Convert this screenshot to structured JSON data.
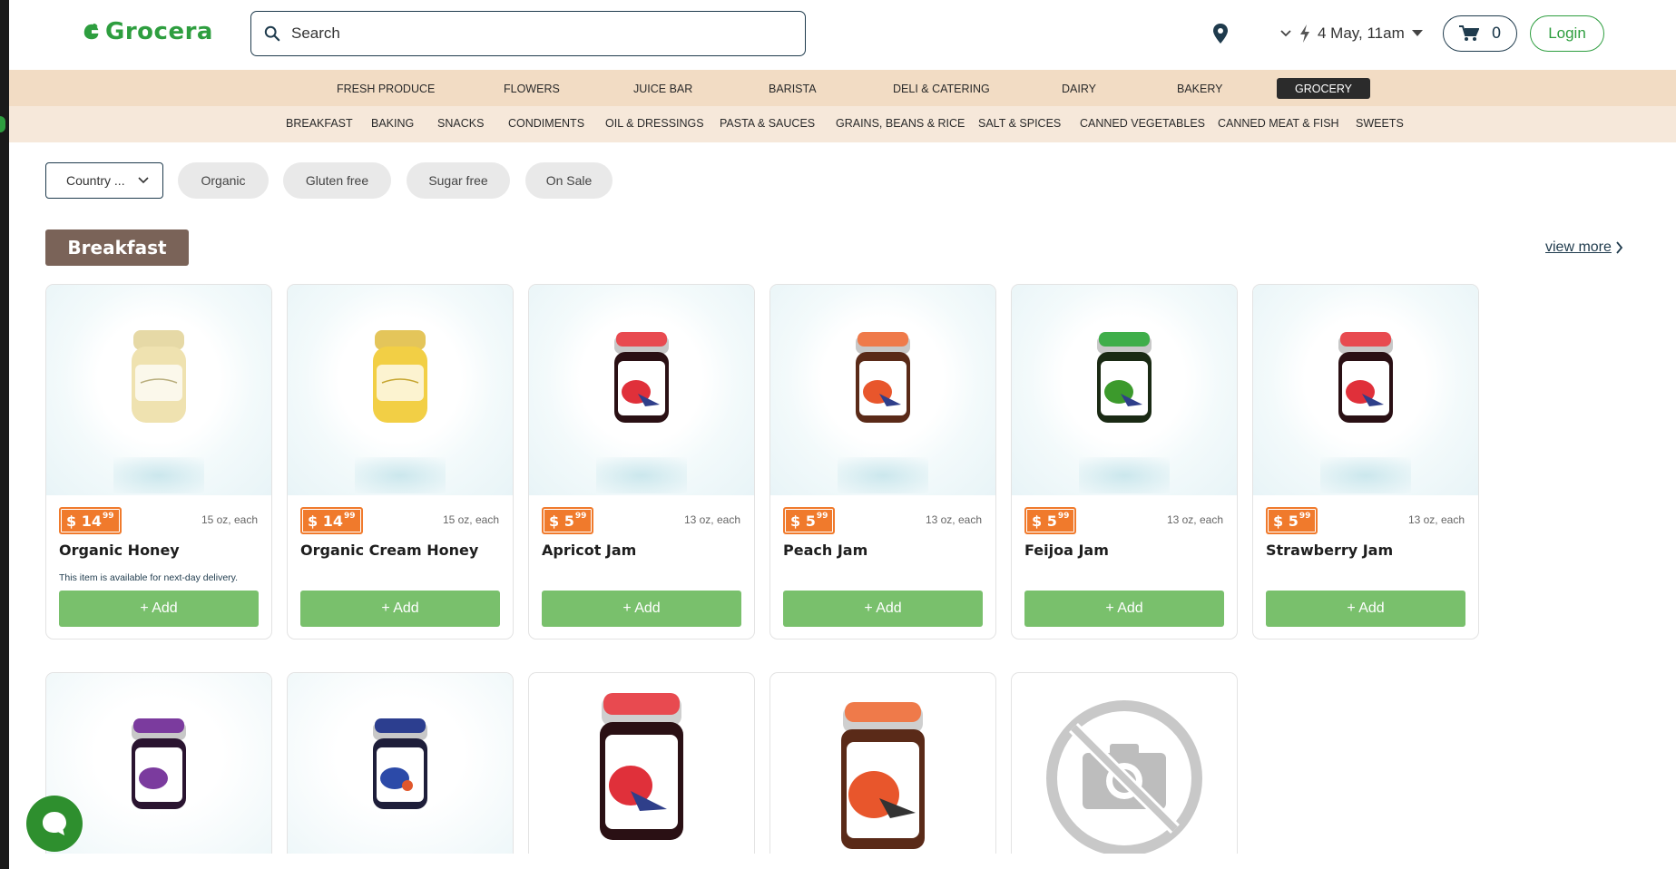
{
  "brand": {
    "name": "Grocera",
    "accent": "#2e9e3f"
  },
  "search": {
    "placeholder": "Search"
  },
  "delivery": {
    "label": "4 May, 11am"
  },
  "cart": {
    "count": "0"
  },
  "login": {
    "label": "Login"
  },
  "nav_main": [
    "FRESH PRODUCE",
    "FLOWERS",
    "JUICE BAR",
    "BARISTA",
    "DELI & CATERING",
    "DAIRY",
    "BAKERY",
    "GROCERY"
  ],
  "nav_sub": [
    "BREAKFAST",
    "BAKING",
    "SNACKS",
    "CONDIMENTS",
    "OIL & DRESSINGS",
    "PASTA & SAUCES",
    "GRAINS, BEANS & RICE",
    "SALT & SPICES",
    "CANNED VEGETABLES",
    "CANNED MEAT & FISH",
    "SWEETS"
  ],
  "filters": {
    "country": "Country ...",
    "pills": [
      "Organic",
      "Gluten free",
      "Sugar free",
      "On Sale"
    ]
  },
  "section": {
    "title": "Breakfast",
    "view_more": "view more"
  },
  "products": [
    {
      "name": "Organic Honey",
      "price_main": "$ 14",
      "price_cents": "99",
      "size": "15 oz, each",
      "note": "This item is available for next-day delivery.",
      "add": "+ Add",
      "jar": "honey"
    },
    {
      "name": "Organic Cream Honey",
      "price_main": "$ 14",
      "price_cents": "99",
      "size": "15 oz, each",
      "add": "+ Add",
      "jar": "cream-honey"
    },
    {
      "name": "Apricot Jam",
      "price_main": "$ 5",
      "price_cents": "99",
      "size": "13 oz, each",
      "add": "+ Add",
      "jar": "red-jam"
    },
    {
      "name": "Peach Jam",
      "price_main": "$ 5",
      "price_cents": "99",
      "size": "13 oz, each",
      "add": "+ Add",
      "jar": "peach-jam"
    },
    {
      "name": "Feijoa Jam",
      "price_main": "$ 5",
      "price_cents": "99",
      "size": "13 oz, each",
      "add": "+ Add",
      "jar": "green-jam"
    },
    {
      "name": "Strawberry Jam",
      "price_main": "$ 5",
      "price_cents": "99",
      "size": "13 oz, each",
      "add": "+ Add",
      "jar": "red-jam"
    }
  ],
  "colors": {
    "price_badge": "#f07a2c",
    "add_button": "#79c06c",
    "nav_main_bg": "#f2dcc4",
    "nav_sub_bg": "#f6e8da",
    "section_bg": "#7a6358"
  }
}
